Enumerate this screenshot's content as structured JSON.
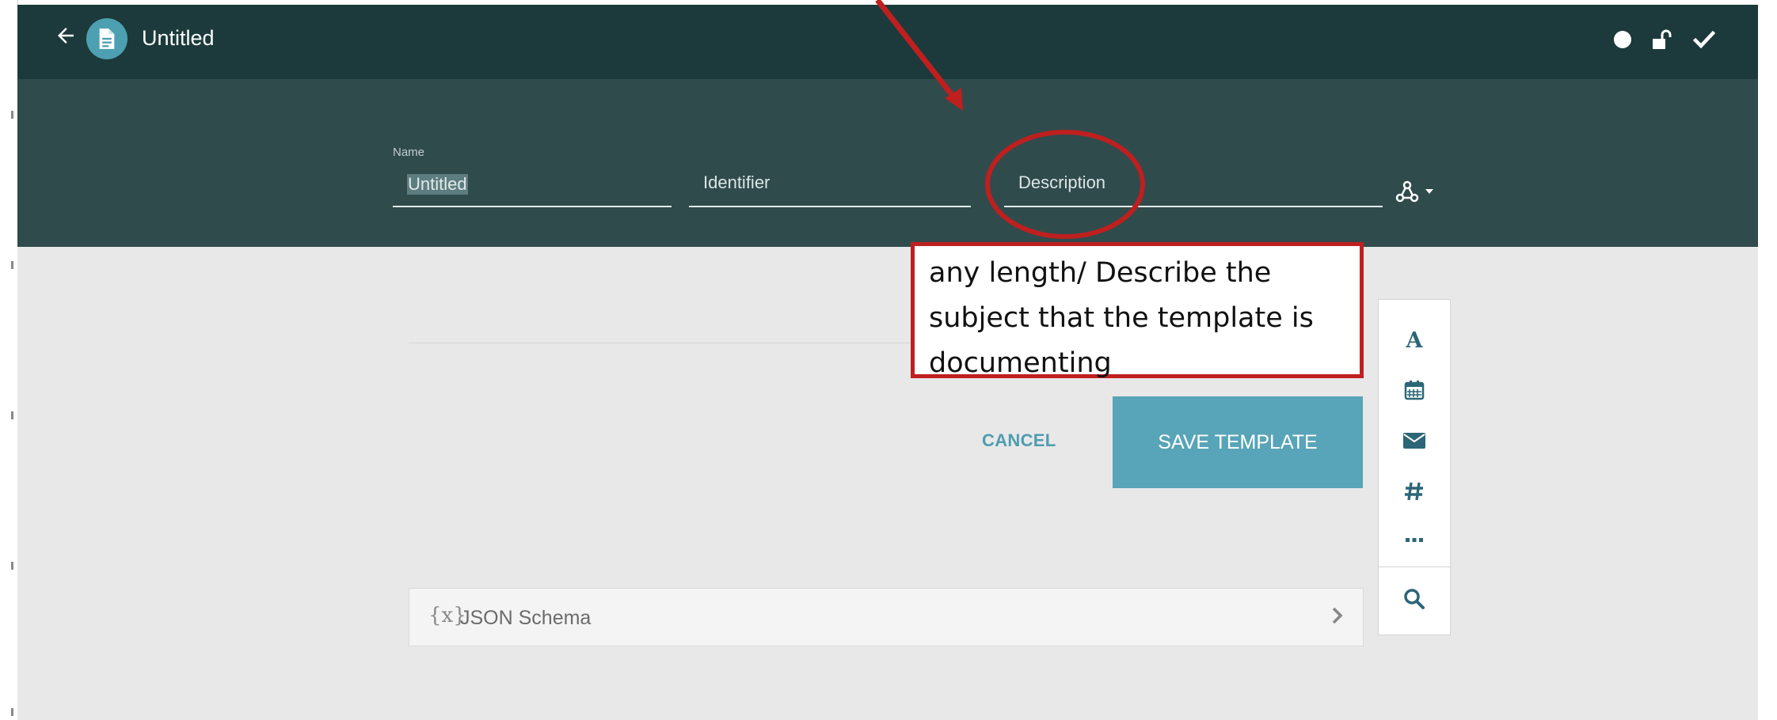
{
  "topbar": {
    "title": "Untitled",
    "back_icon": "arrow-left-icon",
    "doc_icon": "document-icon",
    "status_icon": "circle-icon",
    "lock_icon": "unlock-icon",
    "check_icon": "check-icon"
  },
  "header": {
    "name_label": "Name",
    "name_value": "Untitled",
    "identifier_placeholder": "Identifier",
    "description_placeholder": "Description",
    "access_icon": "sharing-icon"
  },
  "actions": {
    "cancel_label": "CANCEL",
    "save_label": "SAVE TEMPLATE"
  },
  "palette": {
    "items": [
      {
        "icon": "text-field-icon"
      },
      {
        "icon": "calendar-icon"
      },
      {
        "icon": "envelope-icon"
      },
      {
        "icon": "hash-icon"
      },
      {
        "icon": "more-icon"
      },
      {
        "icon": "search-icon"
      }
    ]
  },
  "json_schema": {
    "icon_text": "{x}",
    "label": "JSON Schema"
  },
  "annotation": {
    "text": "any length/ Describe the subject that the template is documenting"
  },
  "colors": {
    "topbar": "#1c3a3b",
    "header": "#304b4c",
    "accent": "#58a4b8",
    "annotation_red": "#bf1f1f"
  }
}
